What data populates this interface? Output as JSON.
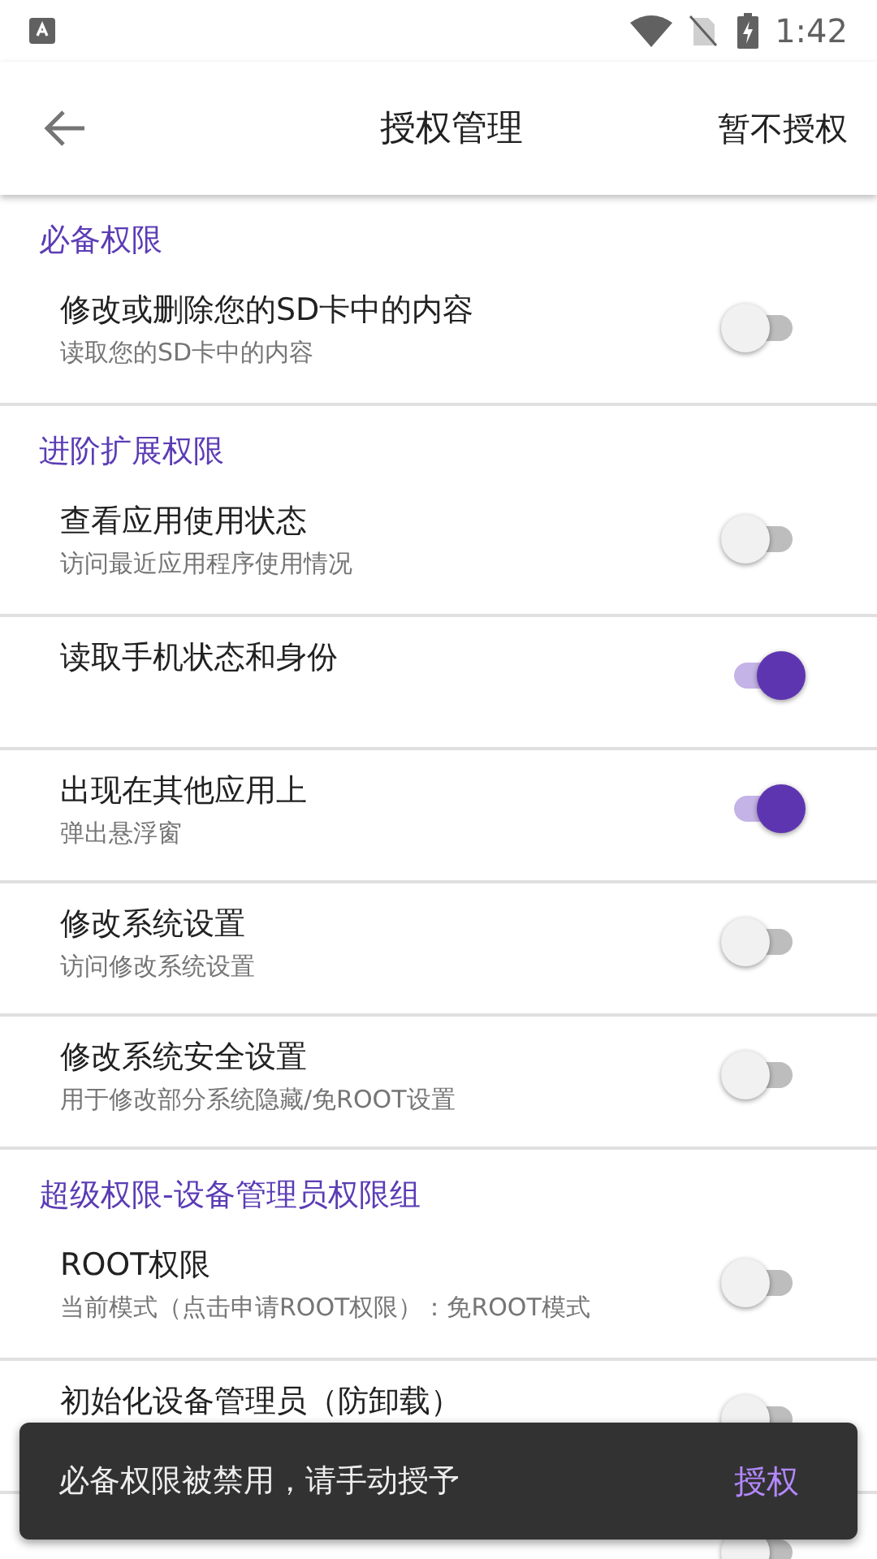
{
  "status_bar": {
    "time": "1:42"
  },
  "app_bar": {
    "title": "授权管理",
    "action": "暂不授权"
  },
  "sections": [
    {
      "title": "必备权限",
      "items": [
        {
          "title": "修改或删除您的SD卡中的内容",
          "subtitle": "读取您的SD卡中的内容",
          "on": false
        }
      ]
    },
    {
      "title": "进阶扩展权限",
      "items": [
        {
          "title": "查看应用使用状态",
          "subtitle": "访问最近应用程序使用情况",
          "on": false
        },
        {
          "title": "读取手机状态和身份",
          "on": true
        },
        {
          "title": "出现在其他应用上",
          "subtitle": "弹出悬浮窗",
          "on": true
        },
        {
          "title": "修改系统设置",
          "subtitle": "访问修改系统设置",
          "on": false
        },
        {
          "title": "修改系统安全设置",
          "subtitle": "用于修改部分系统隐藏/免ROOT设置",
          "on": false
        }
      ]
    },
    {
      "title": "超级权限-设备管理员权限组",
      "items": [
        {
          "title": "ROOT权限",
          "subtitle": "当前模式（点击申请ROOT权限）：免ROOT模式",
          "on": false
        },
        {
          "title": "初始化设备管理员（防卸载）",
          "on": false
        },
        {
          "on": false
        }
      ]
    }
  ],
  "snackbar": {
    "message": "必备权限被禁用，请手动授予",
    "action": "授权"
  }
}
